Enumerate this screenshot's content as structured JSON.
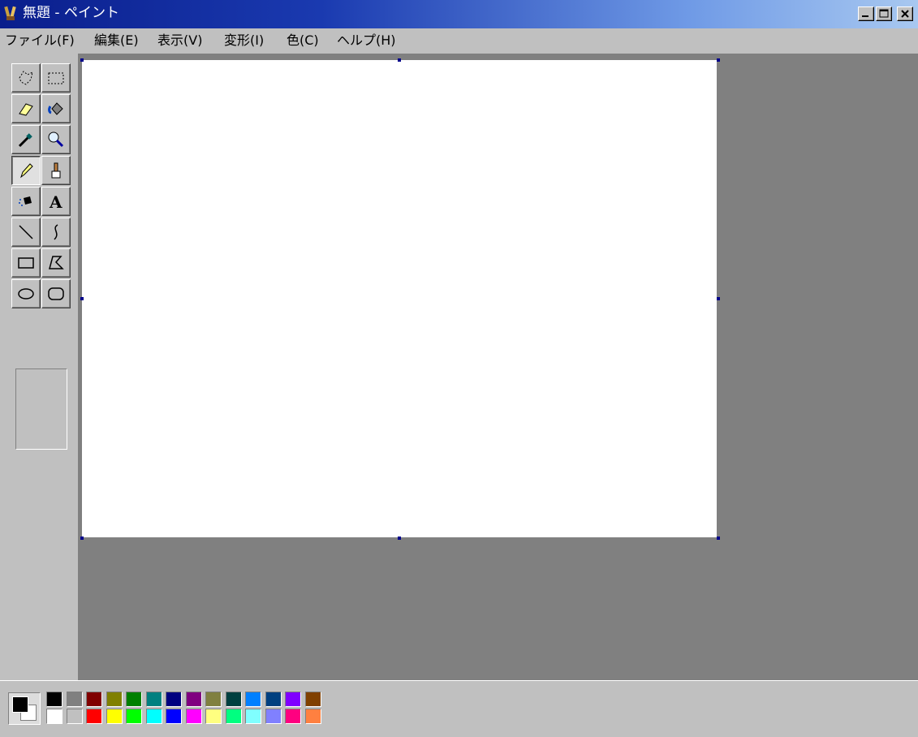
{
  "window": {
    "title": "無題 - ペイント",
    "app_icon": "paint-icon",
    "controls": [
      "minimize-icon",
      "maximize-icon",
      "close-icon"
    ]
  },
  "menubar": {
    "items": [
      {
        "label": "ファイル(F)"
      },
      {
        "label": "編集(E)"
      },
      {
        "label": "表示(V)"
      },
      {
        "label": "変形(I)"
      },
      {
        "label": "色(C)"
      },
      {
        "label": "ヘルプ(H)"
      }
    ]
  },
  "toolbox": {
    "tools": [
      {
        "name": "free-form-select",
        "icon": "free-select-icon"
      },
      {
        "name": "select",
        "icon": "rect-select-icon"
      },
      {
        "name": "eraser",
        "icon": "eraser-icon"
      },
      {
        "name": "fill",
        "icon": "fill-bucket-icon"
      },
      {
        "name": "pick-color",
        "icon": "eyedropper-icon"
      },
      {
        "name": "magnifier",
        "icon": "magnifier-icon"
      },
      {
        "name": "pencil",
        "icon": "pencil-icon",
        "selected": true
      },
      {
        "name": "brush",
        "icon": "brush-icon"
      },
      {
        "name": "airbrush",
        "icon": "airbrush-icon"
      },
      {
        "name": "text",
        "icon": "text-icon",
        "glyph": "A"
      },
      {
        "name": "line",
        "icon": "line-icon"
      },
      {
        "name": "curve",
        "icon": "curve-icon"
      },
      {
        "name": "rectangle",
        "icon": "rectangle-icon"
      },
      {
        "name": "polygon",
        "icon": "polygon-icon"
      },
      {
        "name": "ellipse",
        "icon": "ellipse-icon"
      },
      {
        "name": "rounded-rectangle",
        "icon": "rounded-rect-icon"
      }
    ]
  },
  "colors": {
    "foreground": "#000000",
    "background": "#ffffff",
    "palette_top": [
      "#000000",
      "#808080",
      "#800000",
      "#808000",
      "#008000",
      "#008080",
      "#000080",
      "#800080",
      "#808040",
      "#004040",
      "#0080ff",
      "#004080",
      "#8000ff",
      "#804000"
    ],
    "palette_bottom": [
      "#ffffff",
      "#c0c0c0",
      "#ff0000",
      "#ffff00",
      "#00ff00",
      "#00ffff",
      "#0000ff",
      "#ff00ff",
      "#ffff80",
      "#00ff80",
      "#80ffff",
      "#8080ff",
      "#ff0080",
      "#ff8040"
    ]
  }
}
